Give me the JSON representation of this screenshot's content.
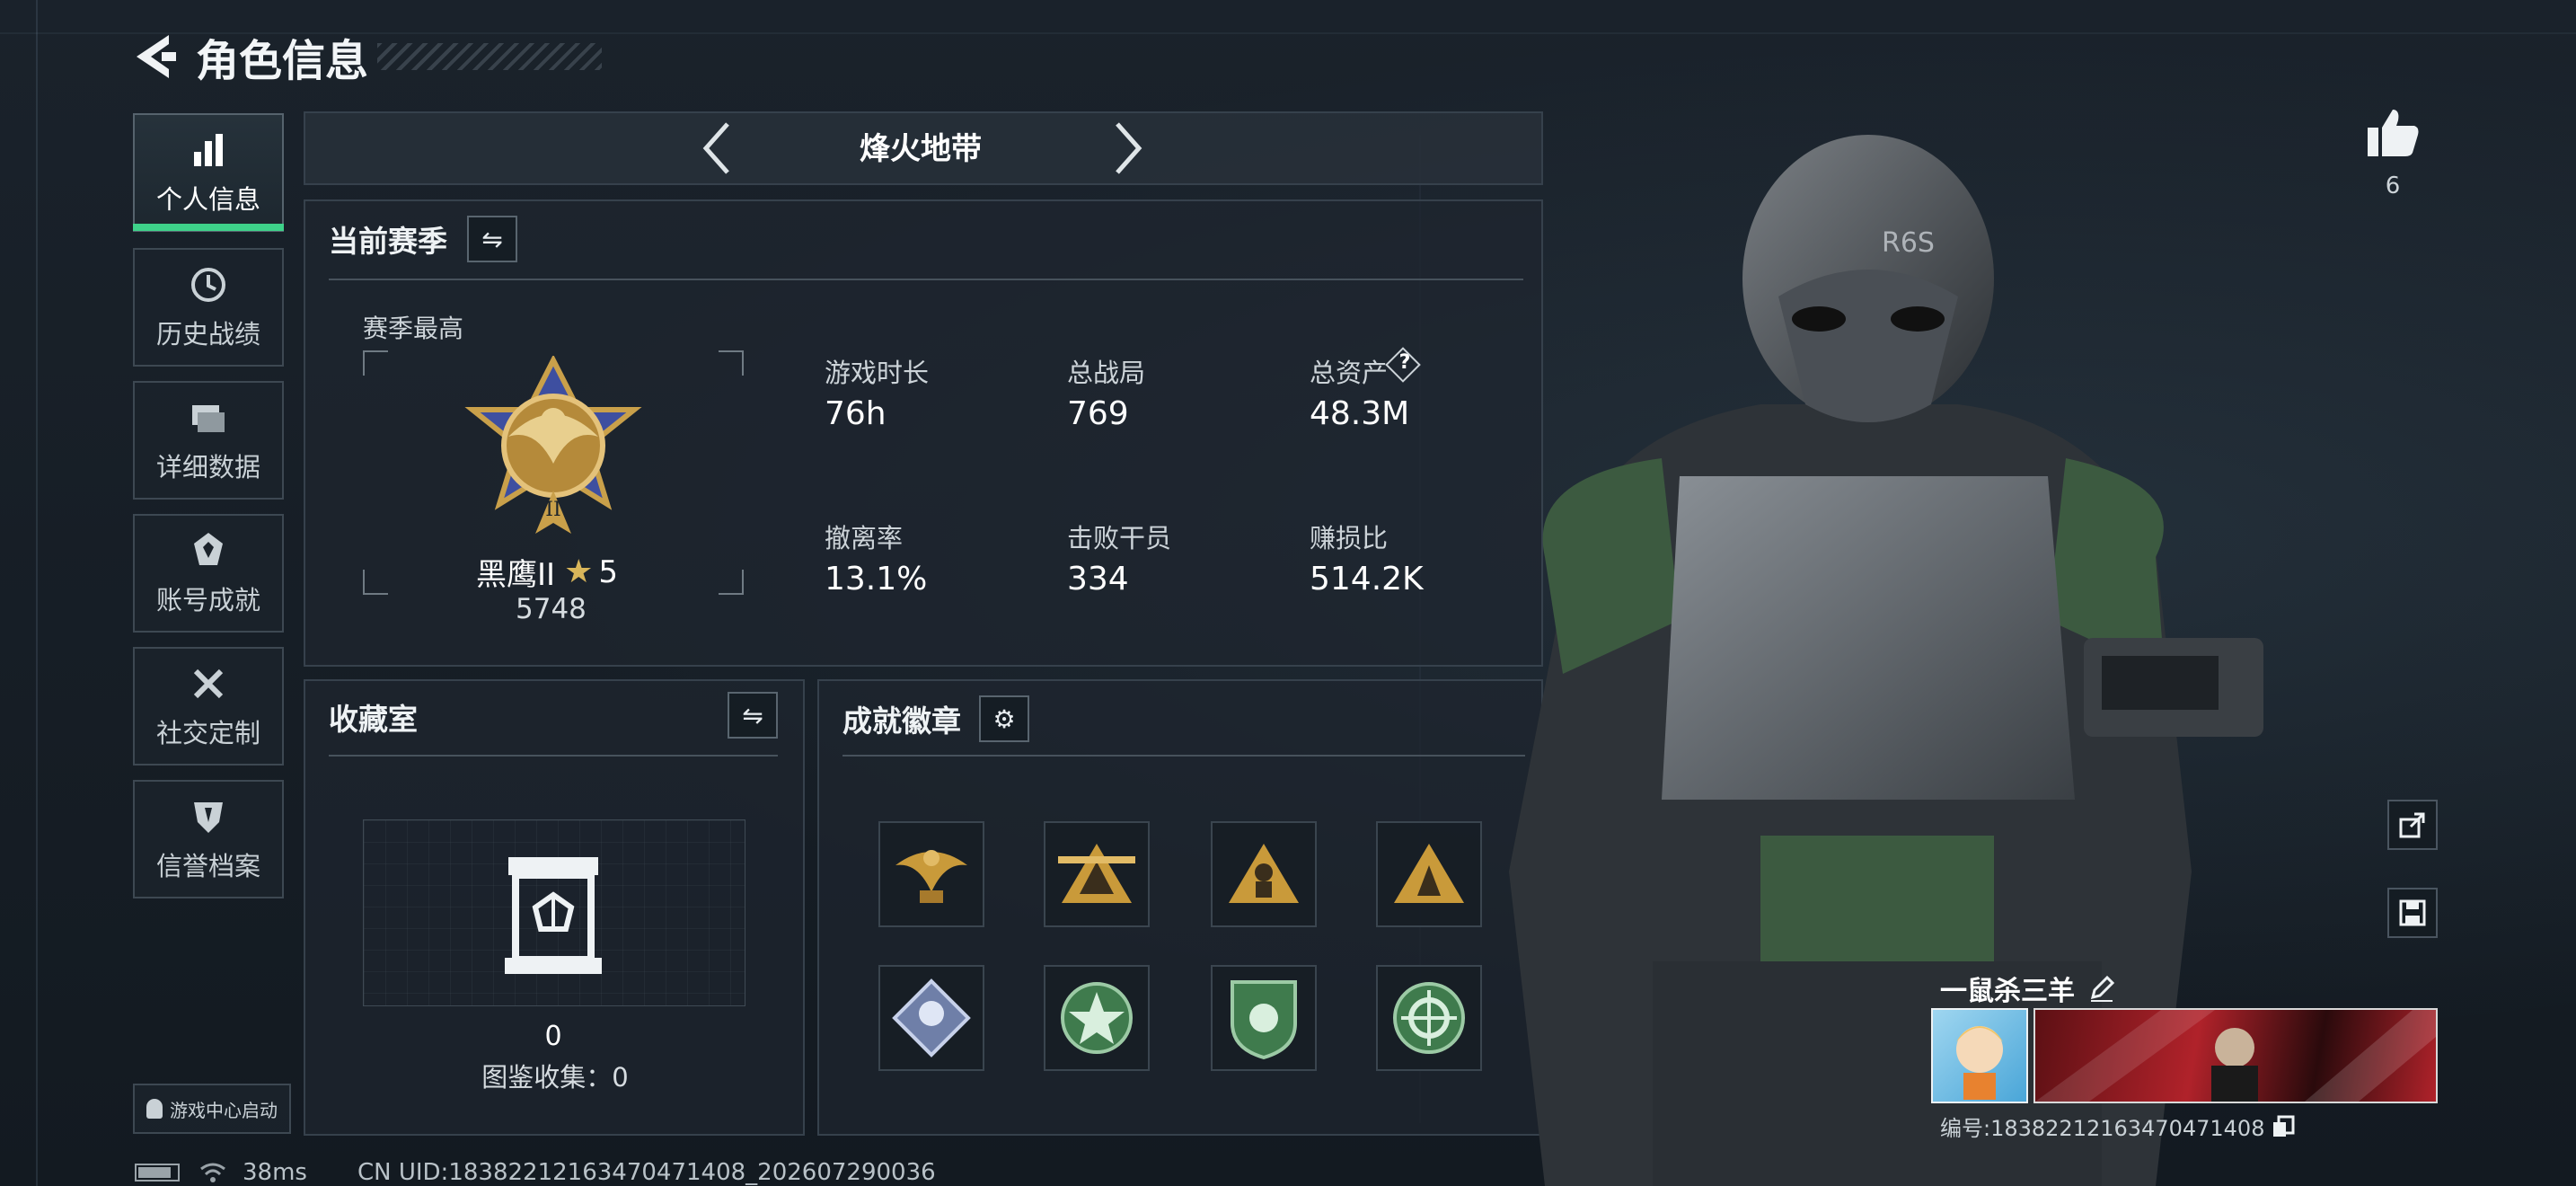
{
  "header": {
    "title": "角色信息"
  },
  "mode_selector": {
    "current": "烽火地带"
  },
  "sidebar": {
    "items": [
      {
        "label": "个人信息",
        "icon": "bar-chart-icon",
        "active": true
      },
      {
        "label": "历史战绩",
        "icon": "history-icon"
      },
      {
        "label": "详细数据",
        "icon": "folder-icon"
      },
      {
        "label": "账号成就",
        "icon": "achievement-icon"
      },
      {
        "label": "社交定制",
        "icon": "tools-icon"
      },
      {
        "label": "信誉档案",
        "icon": "shield-icon"
      }
    ],
    "launcher": "游戏中心启动"
  },
  "season": {
    "title": "当前赛季",
    "best_label": "赛季最高",
    "rank_name": "黑鹰II",
    "rank_stars": "5",
    "rank_points": "5748",
    "stats": [
      {
        "label": "游戏时长",
        "value": "76h"
      },
      {
        "label": "总战局",
        "value": "769"
      },
      {
        "label": "总资产",
        "value": "48.3M"
      },
      {
        "label": "撤离率",
        "value": "13.1%"
      },
      {
        "label": "击败干员",
        "value": "334"
      },
      {
        "label": "赚损比",
        "value": "514.2K"
      }
    ],
    "help_icon": "?"
  },
  "collection": {
    "title": "收藏室",
    "count": "0",
    "caption": "图鉴收集：0"
  },
  "achievements": {
    "title": "成就徽章",
    "badges": [
      {
        "icon": "eagle-badge-icon",
        "color": "#c99a3a"
      },
      {
        "icon": "winged-triangle-badge-icon",
        "color": "#c99a3a"
      },
      {
        "icon": "soldier-triangle-badge-icon",
        "color": "#c99a3a"
      },
      {
        "icon": "fighter-triangle-badge-icon",
        "color": "#c99a3a"
      },
      {
        "icon": "diamond-emblem-badge-icon",
        "color": "#8a9cc8"
      },
      {
        "icon": "star-wreath-badge-icon",
        "color": "#4e8a5a"
      },
      {
        "icon": "shield-crest-badge-icon",
        "color": "#4e8a5a"
      },
      {
        "icon": "target-wreath-badge-icon",
        "color": "#4e8a5a"
      }
    ]
  },
  "profile": {
    "likes": "6",
    "player_name": "一鼠杀三羊",
    "id_text": "编号:1838221216347047140​8"
  },
  "status_bar": {
    "ping": "38ms",
    "uid": "CN UID:18382212163470471408_202607290036"
  },
  "colors": {
    "accent": "#3ed28a",
    "panel_border": "#36414c"
  }
}
